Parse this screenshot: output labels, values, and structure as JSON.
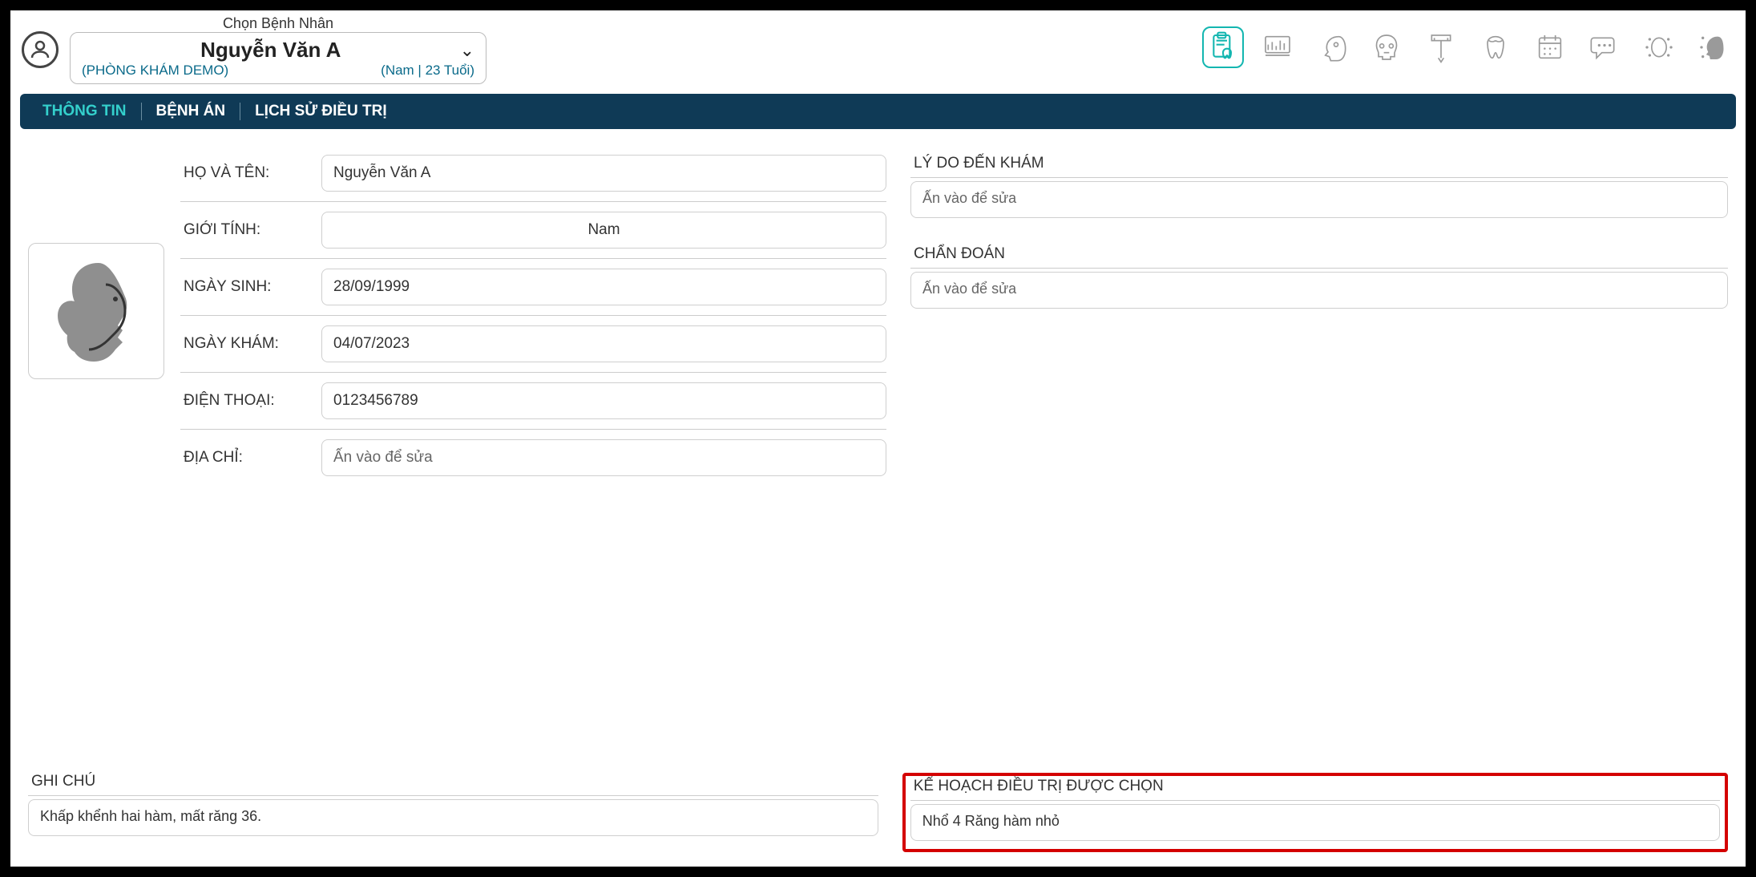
{
  "header": {
    "choose_label": "Chọn Bệnh Nhân",
    "patient_name": "Nguyễn Văn A",
    "clinic": "(PHÒNG KHÁM DEMO)",
    "gender_age": "(Nam | 23 Tuổi)"
  },
  "tabs": {
    "info": "THÔNG TIN",
    "record": "BỆNH ÁN",
    "history": "LỊCH SỬ ĐIỀU TRỊ"
  },
  "fields": {
    "name_label": "HỌ VÀ TÊN:",
    "name_value": "Nguyễn Văn A",
    "gender_label": "GIỚI TÍNH:",
    "gender_value": "Nam",
    "dob_label": "NGÀY SINH:",
    "dob_value": "28/09/1999",
    "exam_label": "NGÀY KHÁM:",
    "exam_value": "04/07/2023",
    "phone_label": "ĐIỆN THOẠI:",
    "phone_value": "0123456789",
    "address_label": "ĐỊA CHỈ:",
    "address_value": "Ấn vào để sửa"
  },
  "right": {
    "reason_title": "LÝ DO ĐẾN KHÁM",
    "reason_value": "Ấn vào để sửa",
    "diag_title": "CHẨN ĐOÁN",
    "diag_value": "Ấn vào để sửa"
  },
  "bottom": {
    "notes_title": "GHI CHÚ",
    "notes_value": "Khấp khểnh hai hàm, mất răng 36.",
    "plan_title": "KẾ HOẠCH ĐIỀU TRỊ ĐƯỢC CHỌN",
    "plan_value": "Nhổ 4 Răng hàm nhỏ"
  },
  "toolbar_icons": [
    "clipboard-tooth",
    "periodontal",
    "skull-side",
    "skull-front",
    "caliper",
    "tooth",
    "calendar",
    "chat",
    "face-dots-front",
    "face-dots-side"
  ]
}
